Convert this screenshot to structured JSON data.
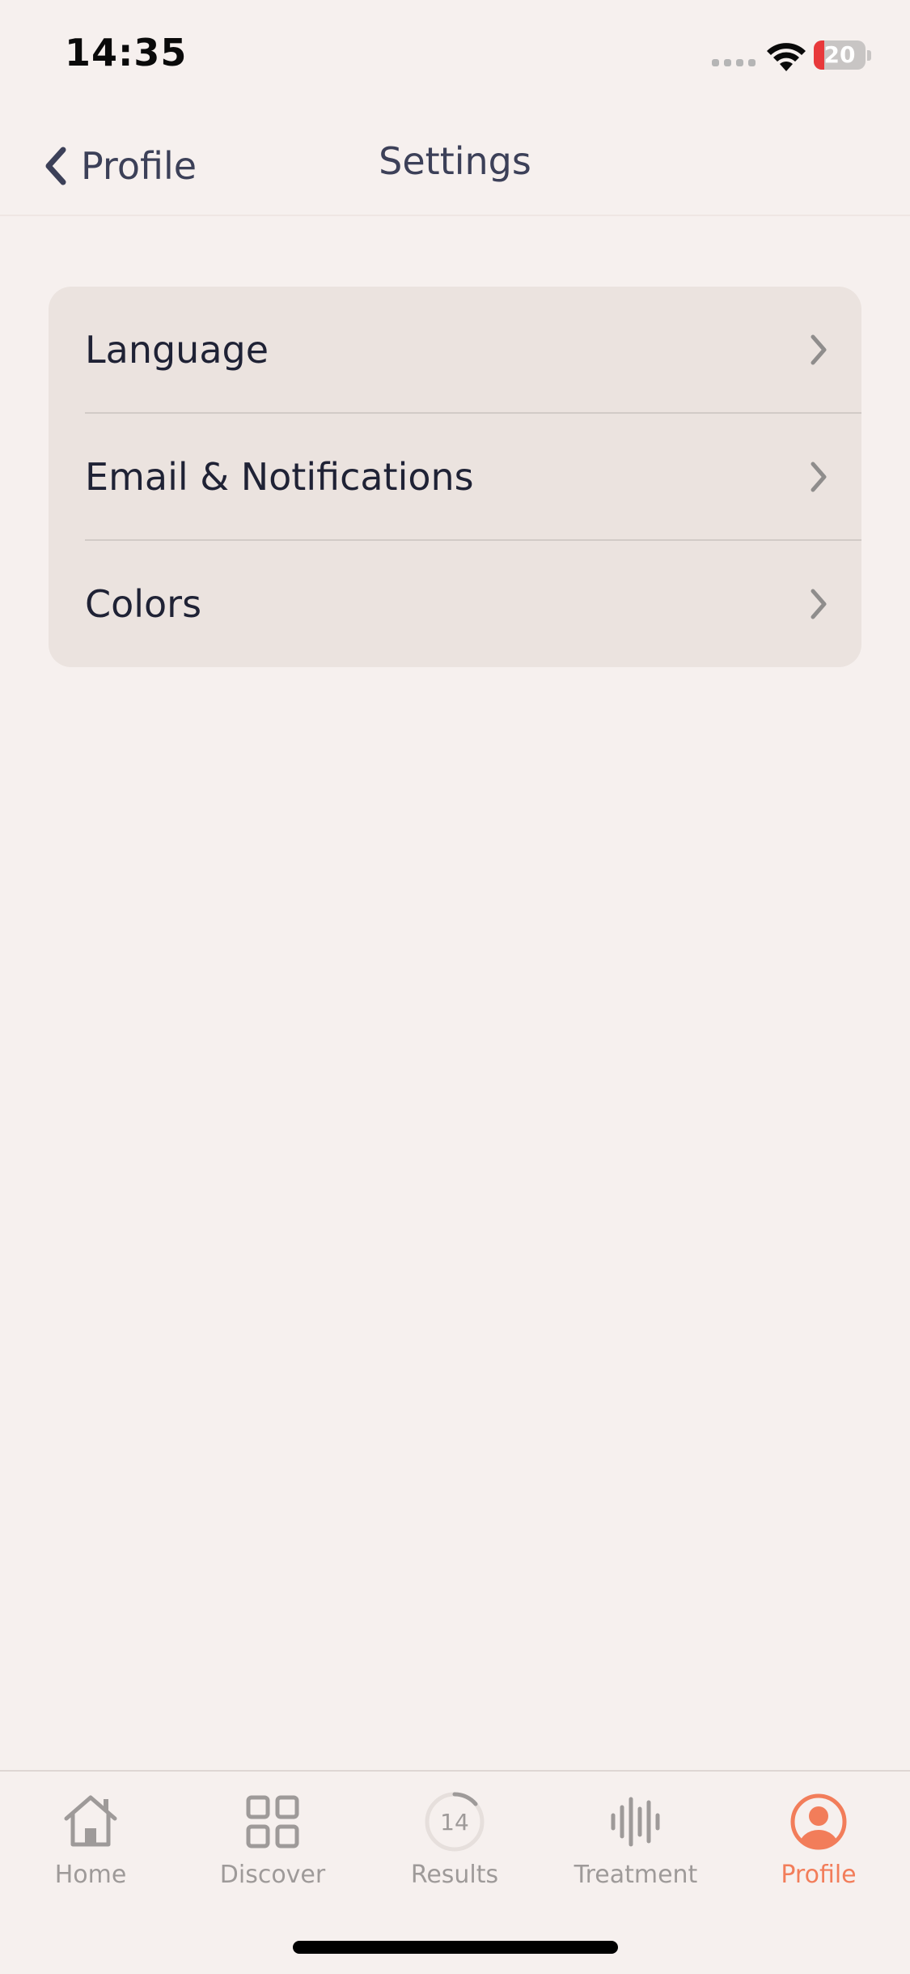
{
  "status_bar": {
    "time": "14:35",
    "battery": "20",
    "battery_color": "#e8393b"
  },
  "nav": {
    "back_label": "Profile",
    "title": "Settings"
  },
  "settings": {
    "items": [
      {
        "label": "Language"
      },
      {
        "label": "Email & Notifications"
      },
      {
        "label": "Colors"
      }
    ]
  },
  "tabbar": {
    "active_color": "#f27d5a",
    "tabs": [
      {
        "label": "Home",
        "icon": "house-icon"
      },
      {
        "label": "Discover",
        "icon": "grid-icon"
      },
      {
        "label": "Results",
        "icon": "progress-ring-icon",
        "badge": "14"
      },
      {
        "label": "Treatment",
        "icon": "waveform-icon"
      },
      {
        "label": "Profile",
        "icon": "person-circle-icon",
        "active": true
      }
    ]
  }
}
